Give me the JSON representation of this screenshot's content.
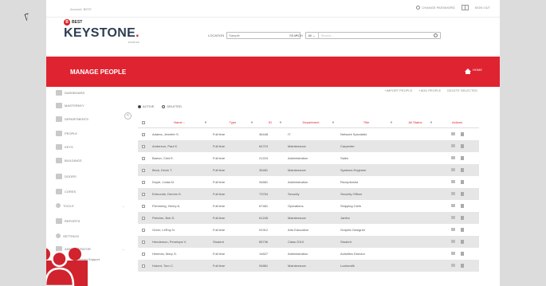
{
  "header": {
    "account_label": "Account: BEST",
    "change_password": "CHANGE PASSWORD",
    "sign_out": "SIGN OUT"
  },
  "logo": {
    "badge": "BEST",
    "name": "KEYSTONE",
    "dot": ".",
    "sub": "ENABLED"
  },
  "location": {
    "label": "LOCATION",
    "value": "Sample"
  },
  "search": {
    "label": "SEARCH",
    "scope": "All",
    "placeholder": "Search..."
  },
  "banner": {
    "title": "MANAGE PEOPLE",
    "home_label": "HOME"
  },
  "sidebar": {
    "items": [
      {
        "label": "DASHBOARD"
      },
      {
        "label": "MASTERKEY"
      },
      {
        "label": "DEPARTMENTS"
      },
      {
        "label": "PEOPLE"
      },
      {
        "label": "KEYS"
      },
      {
        "label": "BUILDINGS"
      },
      {
        "label": "DOORS"
      },
      {
        "label": "CORES"
      },
      {
        "label": "TOOLS"
      },
      {
        "label": "REPORTS"
      },
      {
        "label": "SETTINGS"
      },
      {
        "label": "ADMINISTRATOR"
      },
      {
        "label": "Contact Support"
      }
    ],
    "collapse_symbol": "<"
  },
  "actions": {
    "import": "+IMPORT PEOPLE",
    "add": "+ADD PEOPLE",
    "delete": "DELETE SELECTED"
  },
  "filters": {
    "active": "ACTIVE",
    "deleted": "DELETED"
  },
  "table": {
    "columns": [
      "Name",
      "Type",
      "ID",
      "Department",
      "Title",
      "All Status",
      "Actions"
    ],
    "rows": [
      {
        "name": "Adams, Jennifer S.",
        "type": "Full time",
        "id": "36448",
        "dept": "IT",
        "title": "Network Specialist"
      },
      {
        "name": "Anderson, Paul K.",
        "type": "Full time",
        "id": "64719",
        "dept": "Maintenance",
        "title": "Carpenter"
      },
      {
        "name": "Barton, Clint E.",
        "type": "Full time",
        "id": "21224",
        "dept": "Administration",
        "title": "Sales"
      },
      {
        "name": "Beck, Kevin T.",
        "type": "Full time",
        "id": "35481",
        "dept": "Maintenance",
        "title": "Systems Engineer"
      },
      {
        "name": "Doyle, Linda M.",
        "type": "Full time",
        "id": "34681",
        "dept": "Administration",
        "title": "Receptionist"
      },
      {
        "name": "Edmonds, Dennis H.",
        "type": "Full time",
        "id": "73754",
        "dept": "Security",
        "title": "Security Officer"
      },
      {
        "name": "Flemming, Henry A.",
        "type": "Full time",
        "id": "67481",
        "dept": "Operations",
        "title": "Shipping Clerk"
      },
      {
        "name": "Fletcher, Bob S.",
        "type": "Full time",
        "id": "61245",
        "dept": "Maintenance",
        "title": "Janitor"
      },
      {
        "name": "Greer, LeRoy N.",
        "type": "Full time",
        "id": "91912",
        "dept": "Arts Education",
        "title": "Graphic Designer"
      },
      {
        "name": "Henderson, Penelope V.",
        "type": "Student",
        "id": "85736",
        "dept": "Class 2019",
        "title": "Student"
      },
      {
        "name": "Himmes, Mary G.",
        "type": "Full time",
        "id": "14827",
        "dept": "Administration",
        "title": "Activities Director"
      },
      {
        "name": "Hubert, Tom C.",
        "type": "Full time",
        "id": "94881",
        "dept": "Maintenance",
        "title": "Locksmith"
      }
    ]
  },
  "colors": {
    "brand_red": "#e02330",
    "dark_navy": "#2d3e50"
  },
  "icons": [
    "gear-icon",
    "grid-icon",
    "home-icon",
    "search-icon",
    "people-group-icon"
  ]
}
